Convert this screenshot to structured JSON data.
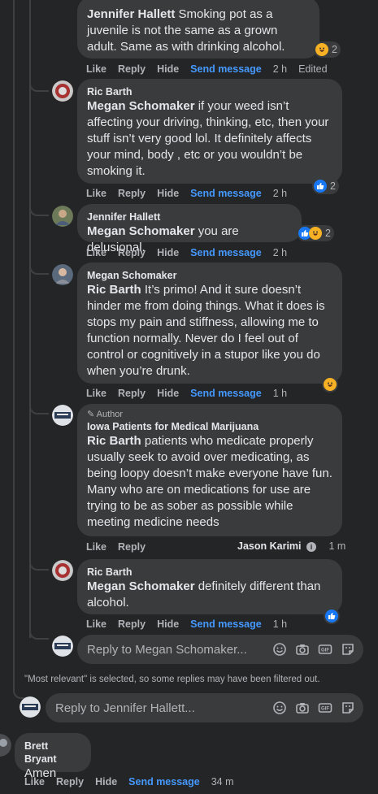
{
  "comments": [
    {
      "author": "Jennifer Hallett",
      "mention": "Jennifer Hallett",
      "text": " Smoking pot as a juvenile is not the same as a grown adult. Same as with drinking alcohol.",
      "show_author": false,
      "reaction_count": "2",
      "time": "2 h",
      "edited": "Edited"
    },
    {
      "author": "Ric Barth",
      "mention": "Megan Schomaker",
      "text": " if your weed isn’t affecting your driving, thinking, etc, then your stuff isn’t very good lol. It definitely affects your mind, body , etc or you wouldn’t be smoking it.",
      "reaction_count": "2",
      "time": "2 h"
    },
    {
      "author": "Jennifer Hallett",
      "mention": "Megan Schomaker",
      "text": " you are delusional.",
      "reaction_count": "2",
      "time": "2 h"
    },
    {
      "author": "Megan Schomaker",
      "mention": "Ric Barth",
      "text": " It’s primo! And it sure doesn’t hinder me from doing things. What it does is stops my pain and stiffness, allowing me to function normally. Never do I feel out of control or cognitively in a stupor like you do when you’re drunk.",
      "time": "1 h"
    },
    {
      "badge": "Author",
      "author": "Iowa Patients for Medical Marijuana",
      "mention": "Ric Barth",
      "text": " patients who medicate properly usually seek to avoid over medicating, as being loopy doesn’t make everyone have fun. Many who are on medications for use are trying to be as sober as possible while meeting medicine needs",
      "reply_author": "Jason Karimi",
      "time": "1 m"
    },
    {
      "author": "Ric Barth",
      "mention": "Megan Schomaker",
      "text": " definitely different than alcohol.",
      "time": "1 h"
    },
    {
      "author": "Brett Bryant",
      "text": "Amen",
      "time": "34 m"
    }
  ],
  "actions": {
    "like": "Like",
    "reply": "Reply",
    "hide": "Hide",
    "send": "Send message"
  },
  "reply_boxes": {
    "megan": "Reply to Megan Schomaker...",
    "jennifer": "Reply to Jennifer Hallett..."
  },
  "filter_note": "\"Most relevant\" is selected, so some replies may have been filtered out.",
  "colors": {
    "background": "#242526",
    "bubble": "#3a3b3c",
    "link": "#4599ff",
    "like": "#1877f2",
    "haha": "#f7b125"
  },
  "icons": [
    "emoji-icon",
    "camera-icon",
    "gif-icon",
    "sticker-icon",
    "pencil-icon",
    "info-icon"
  ]
}
